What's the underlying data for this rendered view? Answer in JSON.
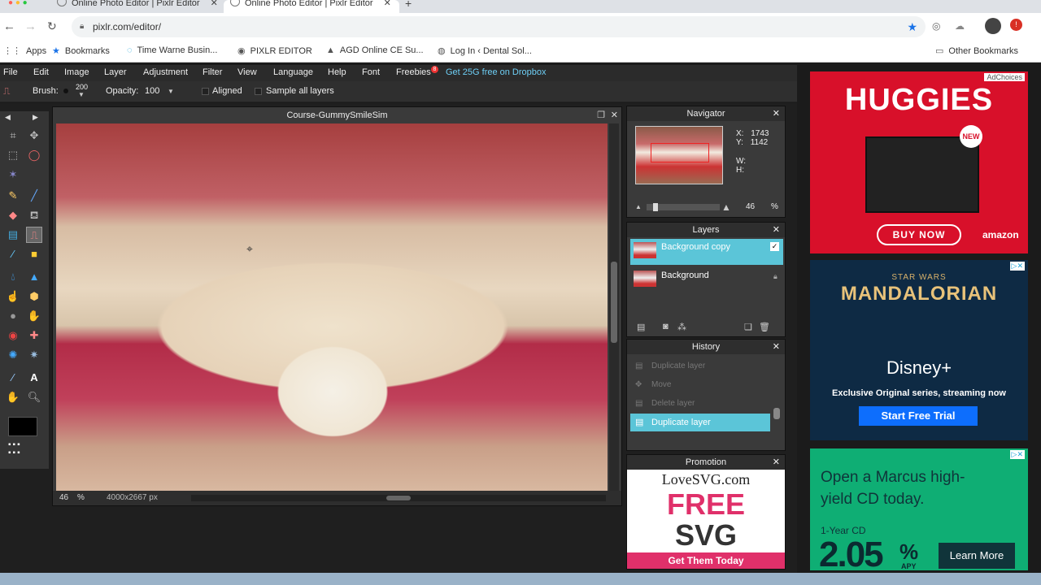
{
  "browser": {
    "tabs": [
      {
        "title": "Online Photo Editor | Pixlr Editor"
      },
      {
        "title": "Online Photo Editor | Pixlr Editor"
      }
    ],
    "url": "pixlr.com/editor/",
    "bookmarks": [
      "Apps",
      "Bookmarks",
      "Time Warne Busin...",
      "PIXLR EDITOR",
      "AGD Online CE Su...",
      "Log In ‹ Dental Sol..."
    ],
    "other_bookmarks": "Other Bookmarks"
  },
  "menu": [
    "File",
    "Edit",
    "Image",
    "Layer",
    "Adjustment",
    "Filter",
    "View",
    "Language",
    "Help",
    "Font",
    "Freebies"
  ],
  "freebies_badge": "8",
  "dropbox_promo": "Get 25G free on Dropbox",
  "options": {
    "brush_label": "Brush:",
    "brush_size": "200",
    "opacity_label": "Opacity:",
    "opacity_value": "100",
    "aligned": "Aligned",
    "sample_all": "Sample all layers"
  },
  "document": {
    "title": "Course-GummySmileSim",
    "zoom": "46",
    "zoom_unit": "%",
    "dimensions": "4000x2667 px"
  },
  "navigator": {
    "title": "Navigator",
    "x_label": "X:",
    "x": "1743",
    "y_label": "Y:",
    "y": "1142",
    "w_label": "W:",
    "h_label": "H:",
    "zoom": "46",
    "zoom_unit": "%"
  },
  "layers": {
    "title": "Layers",
    "items": [
      {
        "name": "Background copy"
      },
      {
        "name": "Background"
      }
    ]
  },
  "history": {
    "title": "History",
    "items": [
      "Duplicate layer",
      "Move",
      "Delete layer",
      "Duplicate layer"
    ]
  },
  "promotion": {
    "title": "Promotion",
    "brand": "LoveSVG.com",
    "free": "FREE",
    "svg": "SVG",
    "cta": "Get Them Today"
  },
  "ads": {
    "huggies": {
      "choices": "AdChoices",
      "brand": "HUGGIES",
      "new": "NEW",
      "cta": "BUY NOW",
      "retailer": "amazon"
    },
    "disney": {
      "title": "MANDALORIAN",
      "subtitle": "STAR WARS",
      "brand": "Disney+",
      "text": "Exclusive Original series, streaming now",
      "cta": "Start Free Trial"
    },
    "marcus": {
      "headline": "Open a Marcus high-yield CD today.",
      "term": "1-Year CD",
      "rate": "2.05",
      "unit": "%",
      "apy": "APY",
      "cta": "Learn More"
    }
  },
  "colors": {
    "accent": "#5bc5d8",
    "dropbox": "#6ecff6",
    "huggies": "#d8102a",
    "marcus": "#0fae74"
  }
}
